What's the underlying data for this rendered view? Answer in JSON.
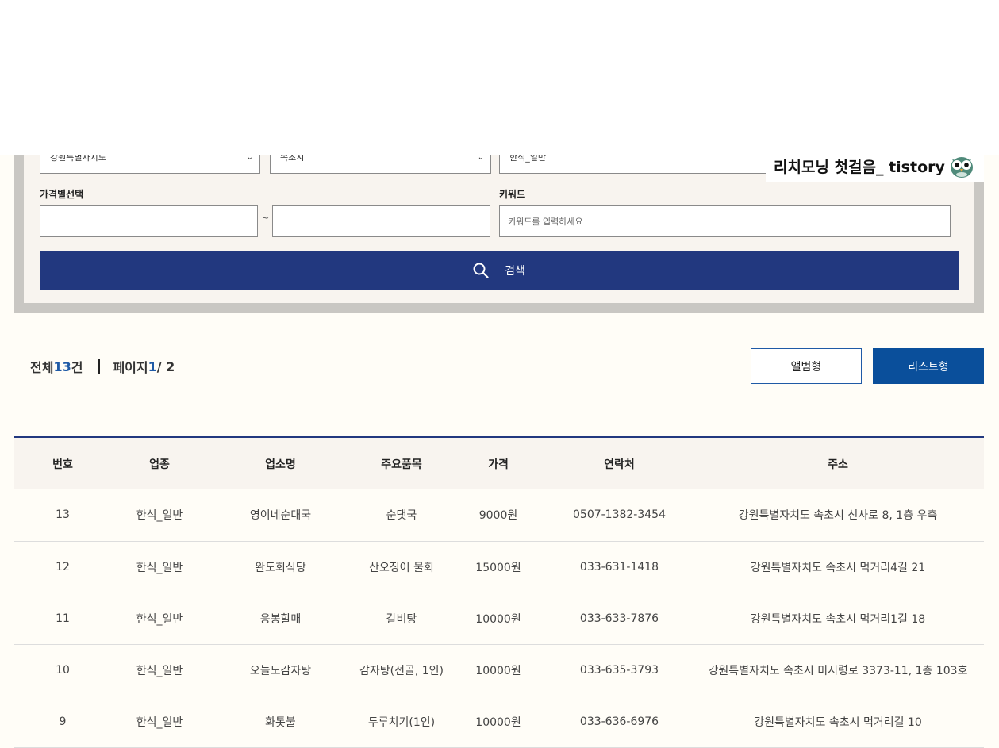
{
  "search": {
    "region_selected": "강원특별자치도",
    "city_selected": "속초시",
    "category_selected": "한식_일반",
    "price_label": "가격별선택",
    "price_min": "",
    "price_max": "",
    "price_separator": "~",
    "keyword_label": "키워드",
    "keyword_value": "",
    "keyword_placeholder": "키워드를 입력하세요",
    "button_label": "검색"
  },
  "watermark": {
    "text": "리치모닝 첫걸음_ tistory",
    "icon": "owl-icon"
  },
  "summary": {
    "total_prefix": "전체 ",
    "total_count": "13",
    "total_suffix": "건",
    "page_prefix": "페이지 ",
    "page_current": "1",
    "page_sep_total": "/ 2"
  },
  "view": {
    "album_label": "앨범형",
    "list_label": "리스트형"
  },
  "table": {
    "headers": [
      "번호",
      "업종",
      "업소명",
      "주요품목",
      "가격",
      "연락처",
      "주소"
    ],
    "rows": [
      [
        "13",
        "한식_일반",
        "영이네순대국",
        "순댓국",
        "9000원",
        "0507-1382-3454",
        "강원특별자치도 속초시 선사로 8, 1층 우측"
      ],
      [
        "12",
        "한식_일반",
        "완도회식당",
        "산오징어 물회",
        "15000원",
        "033-631-1418",
        "강원특별자치도 속초시 먹거리4길 21"
      ],
      [
        "11",
        "한식_일반",
        "응봉할매",
        "갈비탕",
        "10000원",
        "033-633-7876",
        "강원특별자치도 속초시 먹거리1길 18"
      ],
      [
        "10",
        "한식_일반",
        "오늘도감자탕",
        "감자탕(전골, 1인)",
        "10000원",
        "033-635-3793",
        "강원특별자치도 속초시 미시령로 3373-11, 1층 103호"
      ],
      [
        "9",
        "한식_일반",
        "화톳불",
        "두루치기(1인)",
        "10000원",
        "033-636-6976",
        "강원특별자치도 속초시 먹거리길 10"
      ]
    ]
  },
  "colors": {
    "primary_navy": "#22387f",
    "list_button_blue": "#0a4f9b",
    "accent_blue": "#1f5aa6",
    "panel_bg": "#f8f4ef",
    "page_bg": "#fffdf7"
  }
}
